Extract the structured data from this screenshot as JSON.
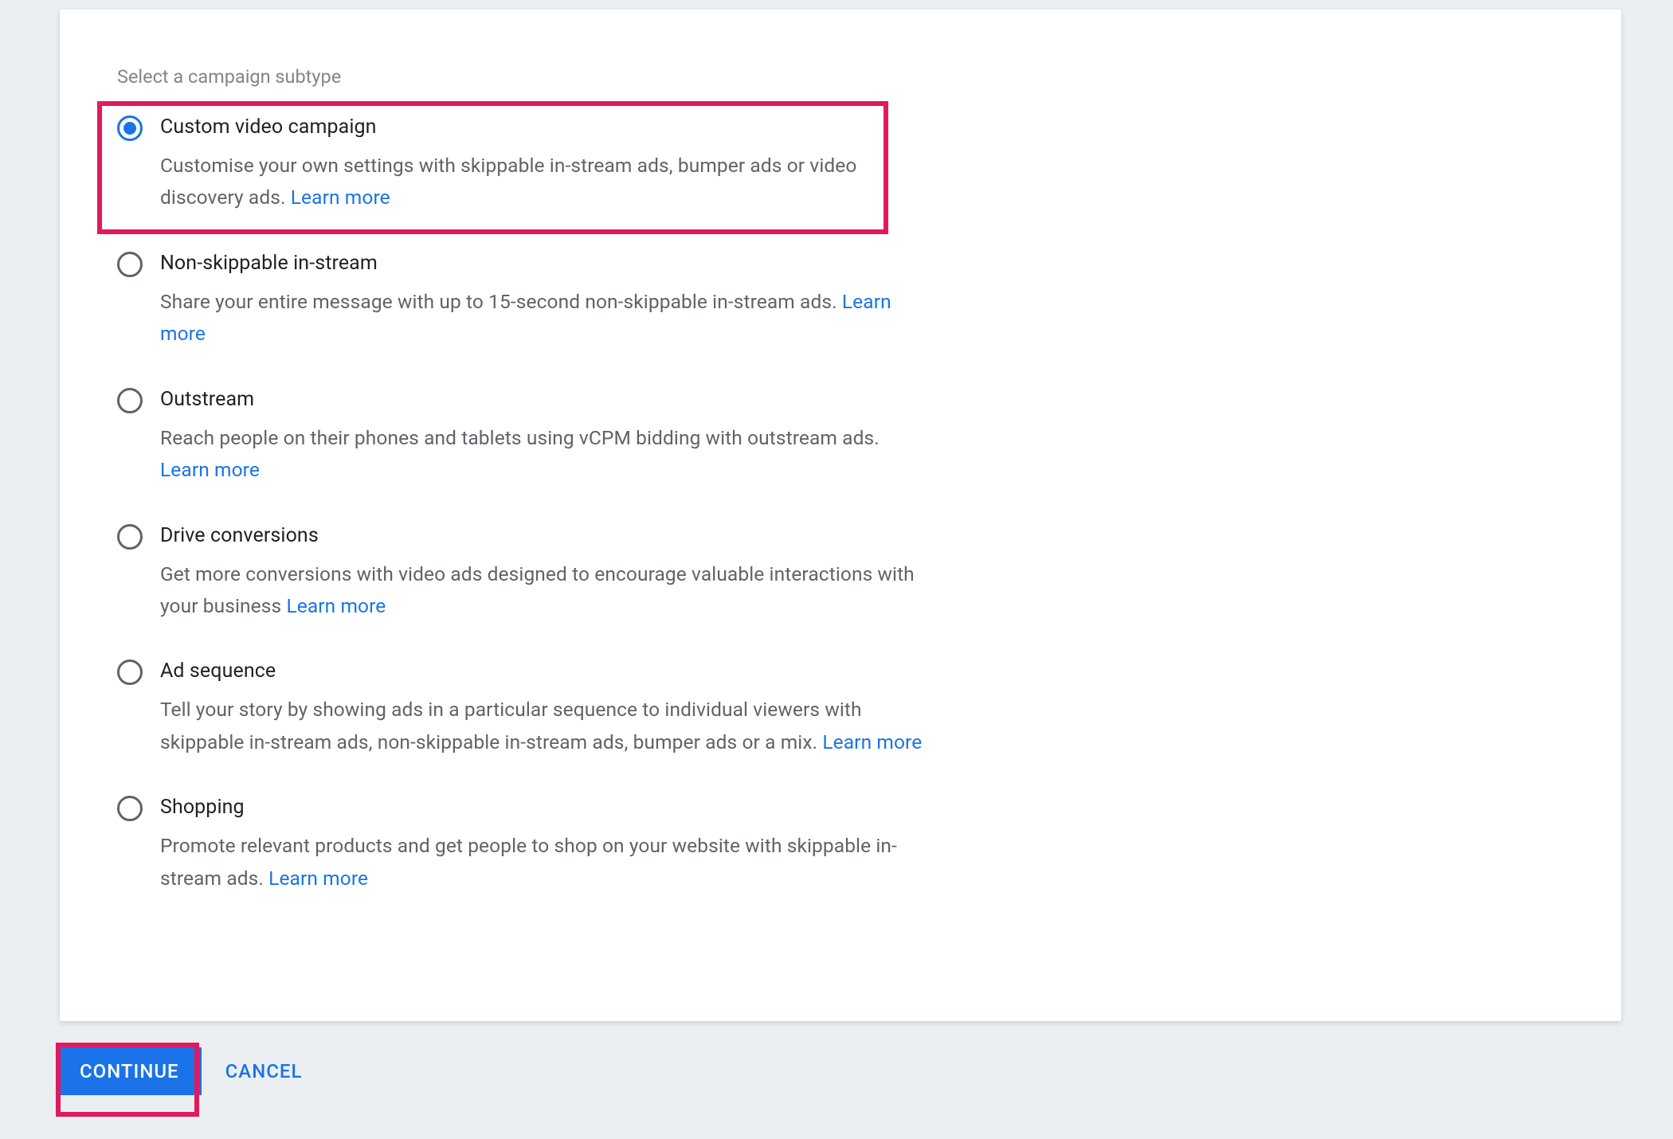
{
  "section": {
    "title": "Select a campaign subtype"
  },
  "options": {
    "o0": {
      "title": "Custom video campaign",
      "desc_pre": "Customise your own settings with skippable in-stream ads, bumper ads or video discovery ads. ",
      "desc_post": "",
      "learn_more": "Learn more"
    },
    "o1": {
      "title": "Non-skippable in-stream",
      "desc_pre": "Share your entire message with up to 15-second non-skippable in-stream ads. ",
      "desc_post": "",
      "learn_more": "Learn more"
    },
    "o2": {
      "title": "Outstream",
      "desc_pre": "Reach people on their phones and tablets using vCPM bidding with outstream ads. ",
      "desc_post": "",
      "learn_more": "Learn more"
    },
    "o3": {
      "title": "Drive conversions",
      "desc_pre": "Get more conversions with video ads designed to encourage valuable interactions with your business ",
      "desc_post": "",
      "learn_more": "Learn more"
    },
    "o4": {
      "title": "Ad sequence",
      "desc_pre": "Tell your story by showing ads in a particular sequence to individual viewers with skippable in-stream ads, non-skippable in-stream ads, bumper ads or a mix. ",
      "desc_post": "",
      "learn_more": "Learn more"
    },
    "o5": {
      "title": "Shopping",
      "desc_pre": "Promote relevant products and get people to shop on your website with skippable in-stream ads. ",
      "desc_post": "",
      "learn_more": "Learn more"
    }
  },
  "buttons": {
    "continue": "CONTINUE",
    "cancel": "CANCEL"
  }
}
